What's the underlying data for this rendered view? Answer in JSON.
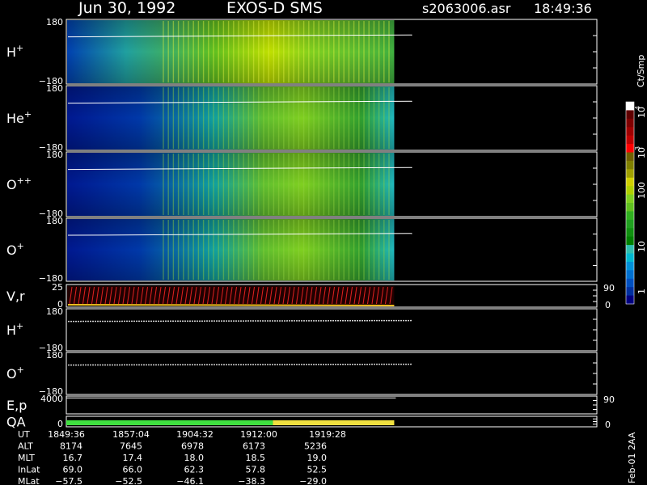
{
  "header": {
    "date": "Jun 30, 1992",
    "instrument": "EXOS-D SMS",
    "file": "s2063006.asr",
    "time": "18:49:36"
  },
  "footer_note": "Feb-01 2AA",
  "colorbar": {
    "units": "Ct/Smp",
    "tick_labels": [
      "1",
      "10",
      "100",
      "10",
      "3",
      "10",
      "4"
    ],
    "colors": [
      "#000080",
      "#0030a0",
      "#0050c0",
      "#0070d0",
      "#0090d8",
      "#00b8d0",
      "#30c0b0",
      "#008000",
      "#109010",
      "#20a020",
      "#30b020",
      "#60c020",
      "#80d020",
      "#b0d000",
      "#d0d000",
      "#a0a000",
      "#808000",
      "#706000",
      "#ff0000",
      "#c00000",
      "#a00000",
      "#800000",
      "#600000",
      "#ffffff"
    ]
  },
  "panels": [
    {
      "key": "h_plus",
      "label": "H",
      "sup": "+",
      "ymax": "180",
      "ymin": "−180"
    },
    {
      "key": "he_plus",
      "label": "He",
      "sup": "+",
      "ymax": "180",
      "ymin": "−180"
    },
    {
      "key": "o_pp",
      "label": "O",
      "sup": "++",
      "ymax": "180",
      "ymin": "−180"
    },
    {
      "key": "o_plus",
      "label": "O",
      "sup": "+",
      "ymax": "180",
      "ymin": "−180"
    },
    {
      "key": "vr",
      "label": "V,r",
      "sup": "",
      "ymax": "25",
      "ymin": "0",
      "rmax": "90",
      "rmin": "0"
    },
    {
      "key": "h_plus_2",
      "label": "H",
      "sup": "+",
      "ymax": "180",
      "ymin": "−180"
    },
    {
      "key": "o_plus_2",
      "label": "O",
      "sup": "+",
      "ymax": "180",
      "ymin": "−180"
    },
    {
      "key": "ep",
      "label": "E,p",
      "sup": "",
      "ymax": "4000",
      "ymin": "",
      "rmax": "90",
      "rmin": ""
    },
    {
      "key": "qa",
      "label": "QA",
      "sup": "",
      "ymax": "",
      "ymin": "0",
      "rmin": "0"
    }
  ],
  "qa_bar": [
    {
      "color": "#40e040",
      "from_fraction": 0.0,
      "to_fraction": 0.63
    },
    {
      "color": "#f0e040",
      "from_fraction": 0.63,
      "to_fraction": 1.0
    }
  ],
  "chart_data": {
    "type": "heatmap",
    "x": [
      "1849:36",
      "1857:04",
      "1904:32",
      "1912:00",
      "1919:28"
    ],
    "ephemeris": [
      {
        "name": "UT",
        "values": [
          "1849:36",
          "1857:04",
          "1904:32",
          "1912:00",
          "1919:28"
        ]
      },
      {
        "name": "ALT",
        "values": [
          "8174",
          "7645",
          "6978",
          "6173",
          "5236"
        ]
      },
      {
        "name": "MLT",
        "values": [
          "16.7",
          "17.4",
          "18.0",
          "18.5",
          "19.0"
        ]
      },
      {
        "name": "InLat",
        "values": [
          "69.0",
          "66.0",
          "62.3",
          "57.8",
          "52.5"
        ]
      },
      {
        "name": "MLat",
        "values": [
          "−57.5",
          "−52.5",
          "−46.1",
          "−38.3",
          "−29.0"
        ]
      }
    ],
    "data_coverage_fraction": 0.49
  }
}
